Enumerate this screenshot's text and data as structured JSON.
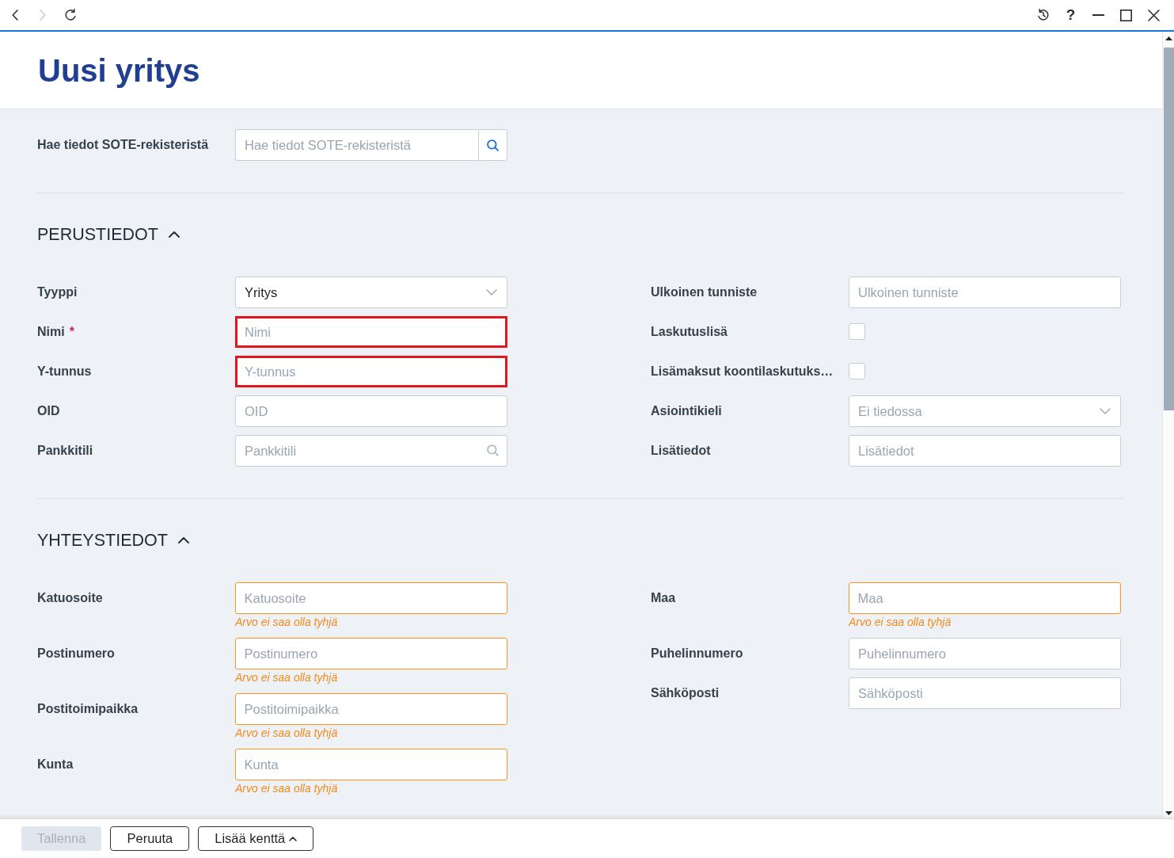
{
  "title_bar": {
    "nav_buttons": [
      {
        "kind": "back",
        "disabled": false
      },
      {
        "kind": "forward",
        "disabled": true
      },
      {
        "kind": "reload",
        "disabled": false
      }
    ],
    "actions": [
      {
        "kind": "history"
      },
      {
        "kind": "help",
        "label": "?"
      },
      {
        "kind": "minimize"
      },
      {
        "kind": "maximize"
      },
      {
        "kind": "close"
      }
    ]
  },
  "page": {
    "title": "Uusi yritys"
  },
  "sote_search": {
    "label": "Hae tiedot SOTE-rekisteristä",
    "placeholder": "Hae tiedot SOTE-rekisteristä"
  },
  "sections": [
    {
      "title": "PERUSTIEDOT",
      "expanded": true,
      "columns": [
        {
          "fields": [
            {
              "kind": "select",
              "label": "Tyyppi",
              "value": "Yritys",
              "invalid": false,
              "warning": false
            },
            {
              "kind": "text",
              "label": "Nimi",
              "required_mark": "*",
              "placeholder": "Nimi",
              "invalid": true,
              "warning": false
            },
            {
              "kind": "text",
              "label": "Y-tunnus",
              "placeholder": "Y-tunnus",
              "invalid": true,
              "warning": false
            },
            {
              "kind": "text",
              "label": "OID",
              "placeholder": "OID",
              "invalid": false,
              "warning": false
            },
            {
              "kind": "lookup",
              "label": "Pankkitili",
              "placeholder": "Pankkitili",
              "invalid": false,
              "warning": false
            }
          ]
        },
        {
          "fields": [
            {
              "kind": "text",
              "label": "Ulkoinen tunniste",
              "placeholder": "Ulkoinen tunniste",
              "invalid": false,
              "warning": false
            },
            {
              "kind": "checkbox",
              "label": "Laskutuslisä",
              "checked": false
            },
            {
              "kind": "checkbox",
              "label": "Lisämaksut koontilaskutuks…",
              "checked": false
            },
            {
              "kind": "select",
              "label": "Asiointikieli",
              "placeholder": "Ei tiedossa",
              "invalid": false,
              "warning": false
            },
            {
              "kind": "text",
              "label": "Lisätiedot",
              "placeholder": "Lisätiedot",
              "invalid": false,
              "warning": false
            }
          ]
        }
      ]
    },
    {
      "title": "YHTEYSTIEDOT",
      "expanded": true,
      "columns": [
        {
          "fields": [
            {
              "kind": "text",
              "label": "Katuosoite",
              "placeholder": "Katuosoite",
              "invalid": false,
              "warning": true,
              "message": "Arvo ei saa olla tyhjä"
            },
            {
              "kind": "text",
              "label": "Postinumero",
              "placeholder": "Postinumero",
              "invalid": false,
              "warning": true,
              "message": "Arvo ei saa olla tyhjä"
            },
            {
              "kind": "text",
              "label": "Postitoimipaikka",
              "placeholder": "Postitoimipaikka",
              "invalid": false,
              "warning": true,
              "message": "Arvo ei saa olla tyhjä"
            },
            {
              "kind": "text",
              "label": "Kunta",
              "placeholder": "Kunta",
              "invalid": false,
              "warning": true,
              "message": "Arvo ei saa olla tyhjä"
            }
          ]
        },
        {
          "fields": [
            {
              "kind": "text",
              "label": "Maa",
              "placeholder": "Maa",
              "invalid": false,
              "warning": true,
              "message": "Arvo ei saa olla tyhjä"
            },
            {
              "kind": "text",
              "label": "Puhelinnumero",
              "placeholder": "Puhelinnumero",
              "invalid": false,
              "warning": false
            },
            {
              "kind": "text",
              "label": "Sähköposti",
              "placeholder": "Sähköposti",
              "invalid": false,
              "warning": false
            }
          ]
        }
      ]
    }
  ],
  "footer": {
    "buttons": [
      {
        "kind": "primary",
        "label": "Tallenna",
        "disabled": true
      },
      {
        "kind": "secondary",
        "label": "Peruuta",
        "disabled": false
      },
      {
        "kind": "menu",
        "label": "Lisää kenttä",
        "disabled": false
      }
    ]
  }
}
